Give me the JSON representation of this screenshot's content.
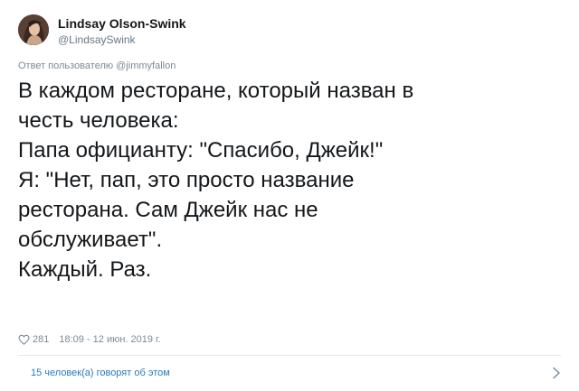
{
  "author": {
    "display_name": "Lindsay Olson-Swink",
    "handle": "@LindsaySwink",
    "avatar_icon": "profile-photo"
  },
  "reply_context": "Ответ пользователю @jimmyfallon",
  "tweet": {
    "lines": [
      "В каждом ресторане, который назван в",
      "честь человека:",
      "Папа официанту: \"Спасибо, Джейк!\"",
      "Я: \"Нет, пап, это просто название",
      "ресторана. Сам Джейк нас не",
      "обслуживает\".",
      "Каждый. Раз."
    ]
  },
  "meta": {
    "like_count": "281",
    "timestamp": "18:09 - 12 июн. 2019 г.",
    "like_icon": "heart-icon"
  },
  "conversation": {
    "people_talking": "15 человек(а) говорят об этом",
    "chevron_icon": "chevron-right-icon"
  },
  "colors": {
    "text": "#14171a",
    "muted": "#7b8a97",
    "link": "#2b7bb9",
    "divider": "#e1e8ed"
  }
}
